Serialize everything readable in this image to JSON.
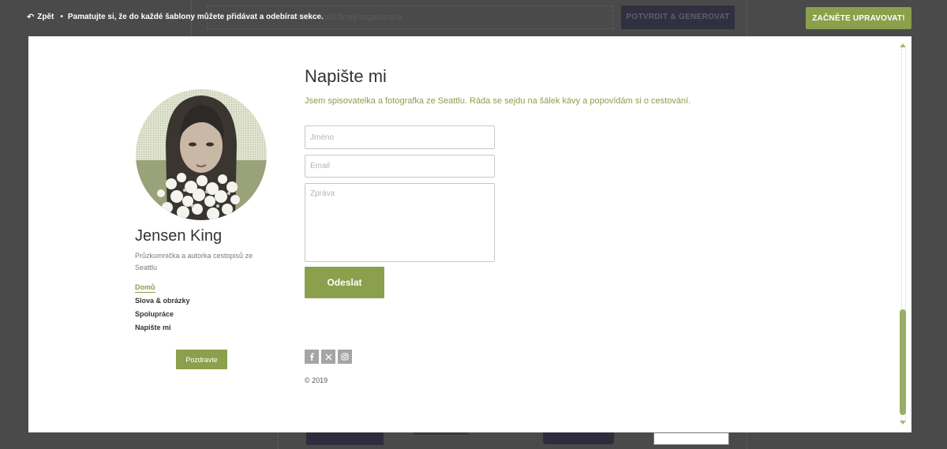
{
  "topbar": {
    "back_label": "Zpět",
    "hint": "Pamatujte si, že do každé šablony můžete přidávat a odebírat sekce.",
    "background_field_placeholder": "název vaší firmy/organizace",
    "background_generate_label": "POTVRDIT & GENEROVAT",
    "start_editing_label": "ZAČNĚTE UPRAVOVAT!"
  },
  "profile": {
    "name": "Jensen King",
    "subtitle": "Průzkumnička a autorka cestopisů ze Seattlu",
    "greet_label": "Pozdravte"
  },
  "nav": {
    "items": [
      {
        "label": "Domů",
        "active": true
      },
      {
        "label": "Slova & obrázky",
        "active": false
      },
      {
        "label": "Spolupráce",
        "active": false
      },
      {
        "label": "Napište mi",
        "active": false
      }
    ]
  },
  "contact": {
    "heading": "Napište mi",
    "intro": "Jsem spisovatelka a fotografka ze Seattlu. Ráda se sejdu na šálek kávy a popovídám si o cestování.",
    "name_placeholder": "Jméno",
    "email_placeholder": "Email",
    "message_placeholder": "Zpráva",
    "send_label": "Odeslat"
  },
  "socials": [
    "facebook-icon",
    "x-icon",
    "instagram-icon"
  ],
  "footer": {
    "copyright": "© 2019"
  },
  "colors": {
    "accent": "#8aa04c",
    "chrome": "#4a4a4a",
    "text": "#333333"
  }
}
